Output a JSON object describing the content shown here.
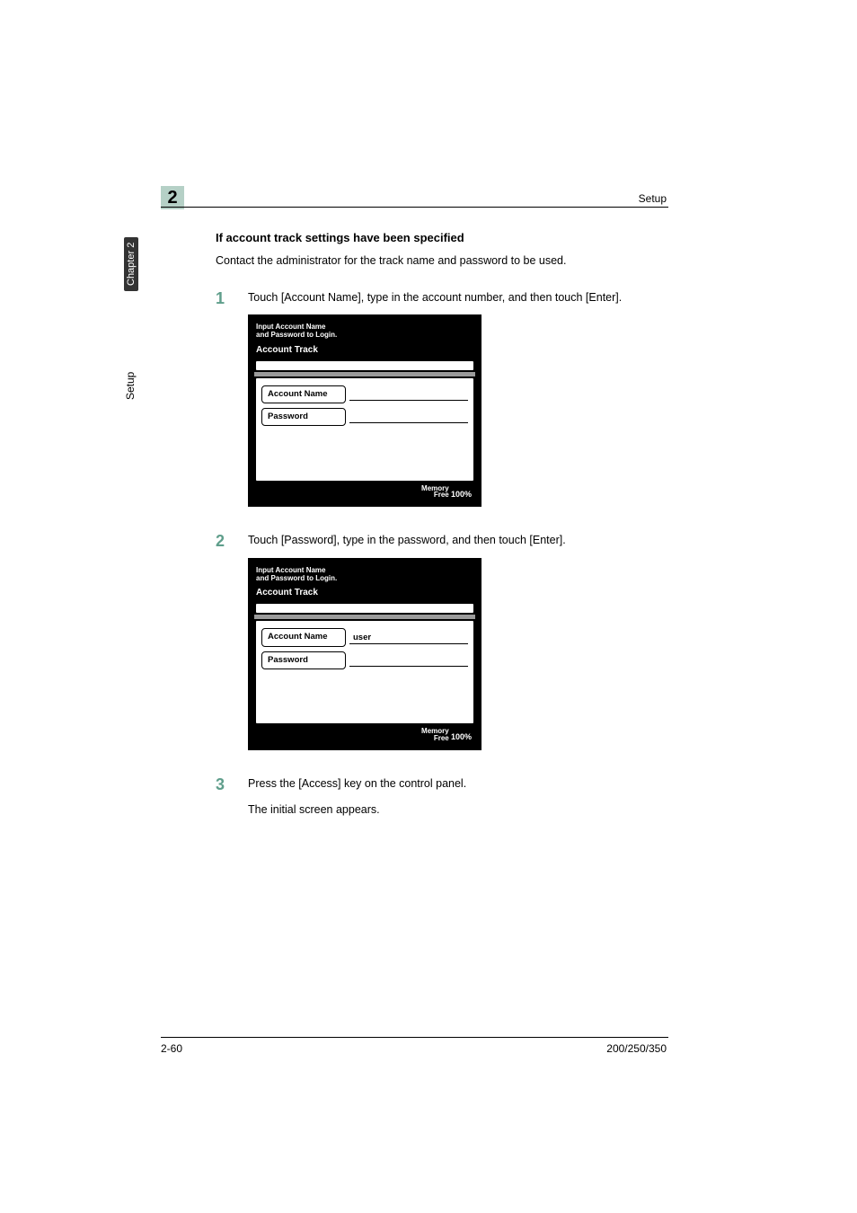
{
  "chapter_badge": "2",
  "header_label": "Setup",
  "sidebar": {
    "chapter_label": "Chapter 2",
    "setup_label": "Setup"
  },
  "section_title": "If account track settings have been specified",
  "intro": "Contact the administrator for the track name and password to be used.",
  "steps": [
    {
      "num": "1",
      "text": "Touch [Account Name], type in the account number, and then touch [Enter].",
      "screen": {
        "header_line1": "Input Account Name",
        "header_line2": "and Password to Login.",
        "title": "Account Track",
        "account_name_btn": "Account Name",
        "account_name_value": "",
        "password_btn": "Password",
        "password_value": "",
        "memory_label": "Memory",
        "free_label": "Free",
        "memory_pct": "100%"
      }
    },
    {
      "num": "2",
      "text": "Touch [Password], type in the password, and then touch [Enter].",
      "screen": {
        "header_line1": "Input Account Name",
        "header_line2": "and Password to Login.",
        "title": "Account Track",
        "account_name_btn": "Account Name",
        "account_name_value": "user",
        "password_btn": "Password",
        "password_value": "",
        "memory_label": "Memory",
        "free_label": "Free",
        "memory_pct": "100%"
      }
    },
    {
      "num": "3",
      "text": "Press the [Access] key on the control panel.",
      "after_text": "The initial screen appears."
    }
  ],
  "footer": {
    "left": "2-60",
    "right": "200/250/350"
  }
}
